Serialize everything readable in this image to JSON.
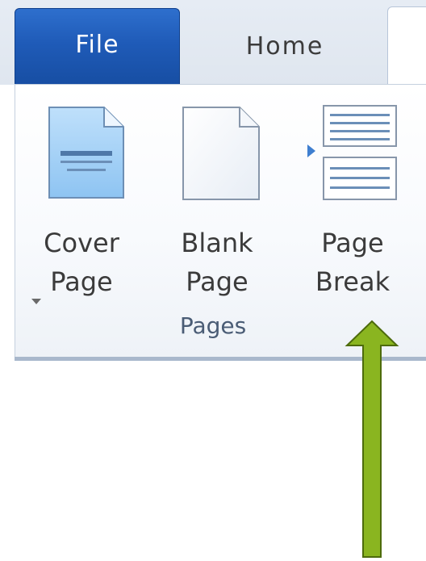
{
  "tabs": {
    "file": "File",
    "home": "Home"
  },
  "ribbon": {
    "group_label": "Pages",
    "buttons": [
      {
        "line1": "Cover",
        "line2": "Page",
        "icon": "cover-page-icon",
        "has_dropdown": true
      },
      {
        "line1": "Blank",
        "line2": "Page",
        "icon": "blank-page-icon",
        "has_dropdown": false
      },
      {
        "line1": "Page",
        "line2": "Break",
        "icon": "page-break-icon",
        "has_dropdown": false
      }
    ]
  },
  "colors": {
    "file_tab": "#1f5bb8",
    "annotation_arrow": "#8ab520",
    "annotation_arrow_outline": "#4d6b0c"
  }
}
